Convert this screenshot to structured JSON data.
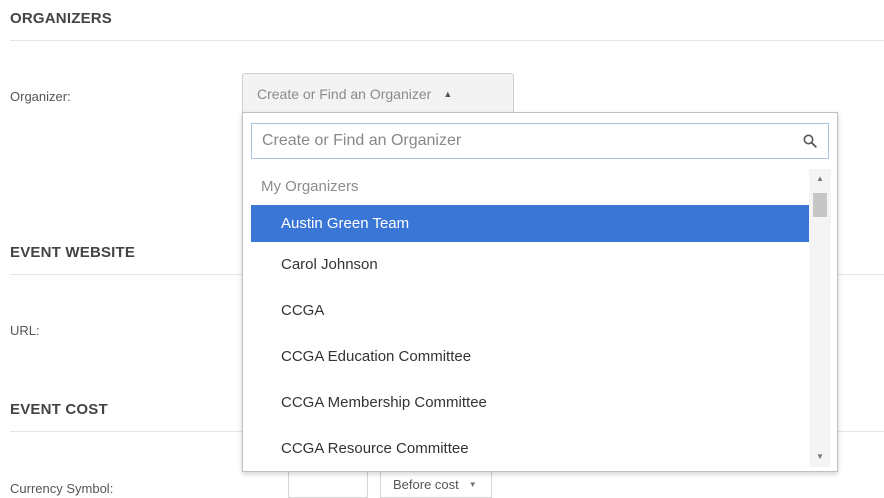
{
  "sections": {
    "organizers": "ORGANIZERS",
    "website": "EVENT WEBSITE",
    "cost": "EVENT COST"
  },
  "labels": {
    "organizer": "Organizer:",
    "url": "URL:",
    "currency_symbol": "Currency Symbol:"
  },
  "organizer_select": {
    "value": "Create or Find an Organizer",
    "caret": "▲"
  },
  "dropdown": {
    "search_placeholder": "Create or Find an Organizer",
    "group_label": "My Organizers",
    "items": [
      "Austin Green Team",
      "Carol Johnson",
      "CCGA",
      "CCGA Education Committee",
      "CCGA Membership Committee",
      "CCGA Resource Committee"
    ],
    "selected_index": 0,
    "selected_color": "#3a76d6"
  },
  "currency_position": {
    "value": "Before cost",
    "caret": "▼"
  },
  "scrollbar": {
    "up": "▲",
    "down": "▼"
  }
}
